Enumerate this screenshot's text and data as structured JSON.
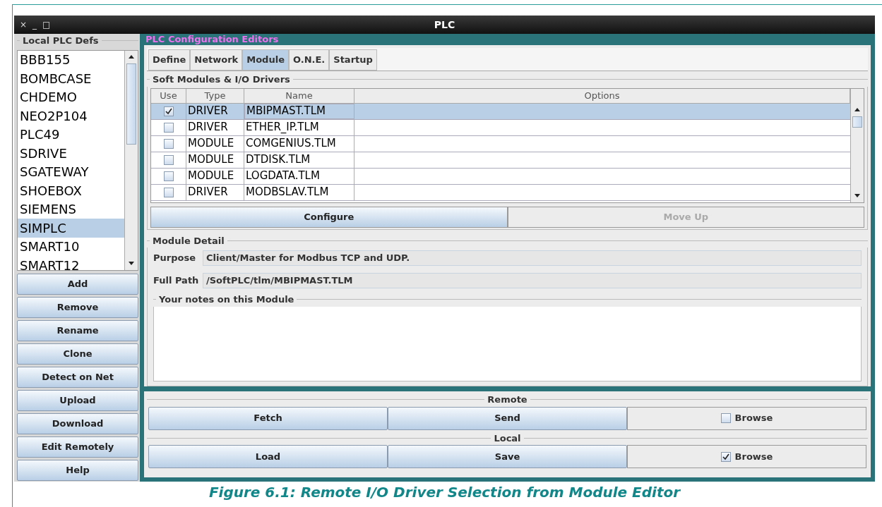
{
  "window": {
    "title": "PLC",
    "controls": [
      "×",
      "_",
      "□"
    ]
  },
  "sidebar": {
    "title": "Local PLC Defs",
    "items": [
      {
        "label": "BBB155",
        "selected": false
      },
      {
        "label": "BOMBCASE",
        "selected": false
      },
      {
        "label": "CHDEMO",
        "selected": false
      },
      {
        "label": "NEO2P104",
        "selected": false
      },
      {
        "label": "PLC49",
        "selected": false
      },
      {
        "label": "SDRIVE",
        "selected": false
      },
      {
        "label": "SGATEWAY",
        "selected": false
      },
      {
        "label": "SHOEBOX",
        "selected": false
      },
      {
        "label": "SIEMENS",
        "selected": false
      },
      {
        "label": "SIMPLC",
        "selected": true
      },
      {
        "label": "SMART10",
        "selected": false
      },
      {
        "label": "SMART12",
        "selected": false
      }
    ],
    "buttons": [
      "Add",
      "Remove",
      "Rename",
      "Clone",
      "Detect on Net",
      "Upload",
      "Download",
      "Edit Remotely",
      "Help"
    ]
  },
  "editors": {
    "title": "PLC Configuration Editors",
    "tabs": [
      {
        "label": "Define",
        "selected": false
      },
      {
        "label": "Network",
        "selected": false
      },
      {
        "label": "Module",
        "selected": true
      },
      {
        "label": "O.N.E.",
        "selected": false
      },
      {
        "label": "Startup",
        "selected": false
      }
    ],
    "modules": {
      "title": "Soft Modules & I/O Drivers",
      "columns": [
        "Use",
        "Type",
        "Name",
        "Options"
      ],
      "rows": [
        {
          "checked": true,
          "selected": true,
          "type": "DRIVER",
          "name": "MBIPMAST.TLM"
        },
        {
          "checked": false,
          "selected": false,
          "type": "DRIVER",
          "name": "ETHER_IP.TLM"
        },
        {
          "checked": false,
          "selected": false,
          "type": "MODULE",
          "name": "COMGENIUS.TLM"
        },
        {
          "checked": false,
          "selected": false,
          "type": "MODULE",
          "name": "DTDISK.TLM"
        },
        {
          "checked": false,
          "selected": false,
          "type": "MODULE",
          "name": "LOGDATA.TLM"
        },
        {
          "checked": false,
          "selected": false,
          "type": "DRIVER",
          "name": "MODBSLAV.TLM"
        }
      ],
      "buttons": [
        {
          "label": "Configure",
          "disabled": false
        },
        {
          "label": "Move Up",
          "disabled": true
        }
      ]
    },
    "detail": {
      "title": "Module Detail",
      "fields": [
        {
          "label": "Purpose",
          "value": "Client/Master for Modbus TCP and UDP."
        },
        {
          "label": "Full Path",
          "value": "/SoftPLC/tlm/MBIPMAST.TLM"
        }
      ],
      "notes_title": "Your notes on this Module"
    }
  },
  "transfer": [
    {
      "title": "Remote",
      "buttons": [
        "Fetch",
        "Send"
      ],
      "browse": {
        "label": "Browse",
        "checked": false
      }
    },
    {
      "title": "Local",
      "buttons": [
        "Load",
        "Save"
      ],
      "browse": {
        "label": "Browse",
        "checked": true
      }
    }
  ],
  "caption": "Figure 6.1: Remote I/O Driver Selection from Module Editor"
}
